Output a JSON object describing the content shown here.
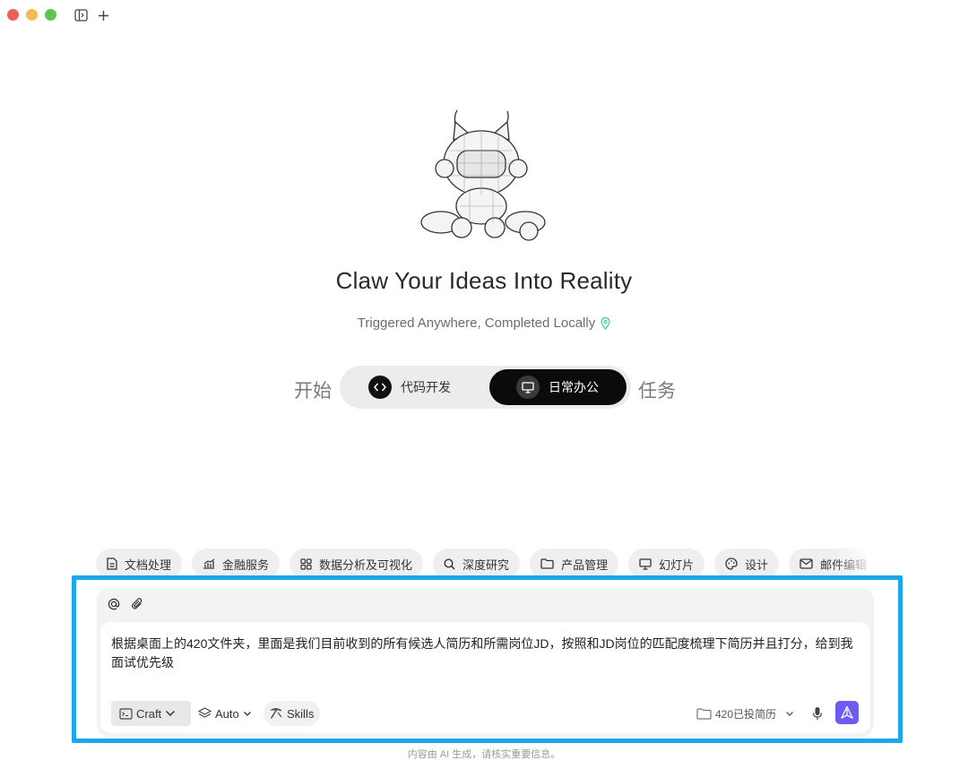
{
  "window": {
    "controls": [
      "close",
      "minimize",
      "zoom"
    ],
    "toolbar_icons": [
      "sidebar-toggle-icon",
      "plus-icon"
    ]
  },
  "hero": {
    "headline": "Claw Your Ideas Into Reality",
    "tagline": "Triggered Anywhere, Completed Locally"
  },
  "mode_switch": {
    "prefix": "开始",
    "suffix": "任务",
    "options": [
      {
        "label": "代码开发",
        "icon": "code-icon",
        "selected": false
      },
      {
        "label": "日常办公",
        "icon": "monitor-icon",
        "selected": true
      }
    ]
  },
  "categories": [
    {
      "label": "文档处理",
      "icon": "document-icon"
    },
    {
      "label": "金融服务",
      "icon": "stock-chart-icon"
    },
    {
      "label": "数据分析及可视化",
      "icon": "grid-icon"
    },
    {
      "label": "深度研究",
      "icon": "search-icon"
    },
    {
      "label": "产品管理",
      "icon": "folder-icon"
    },
    {
      "label": "幻灯片",
      "icon": "presentation-icon"
    },
    {
      "label": "设计",
      "icon": "palette-icon"
    },
    {
      "label": "邮件编辑",
      "icon": "mail-icon"
    }
  ],
  "composer": {
    "prompt_text": "根据桌面上的420文件夹，里面是我们目前收到的所有候选人简历和所需岗位JD，按照和JD岗位的匹配度梳理下简历并且打分，给到我面试优先级",
    "mode_label": "Craft",
    "model_label": "Auto",
    "skills_label": "Skills",
    "folder_label": "420已投简历"
  },
  "footer": {
    "disclaimer": "内容由 AI 生成，请核实重要信息。"
  },
  "colors": {
    "highlight_frame": "#1aa7ec",
    "send_button": "#6d5cf4",
    "tagline_pin": "#3ac7a0"
  }
}
